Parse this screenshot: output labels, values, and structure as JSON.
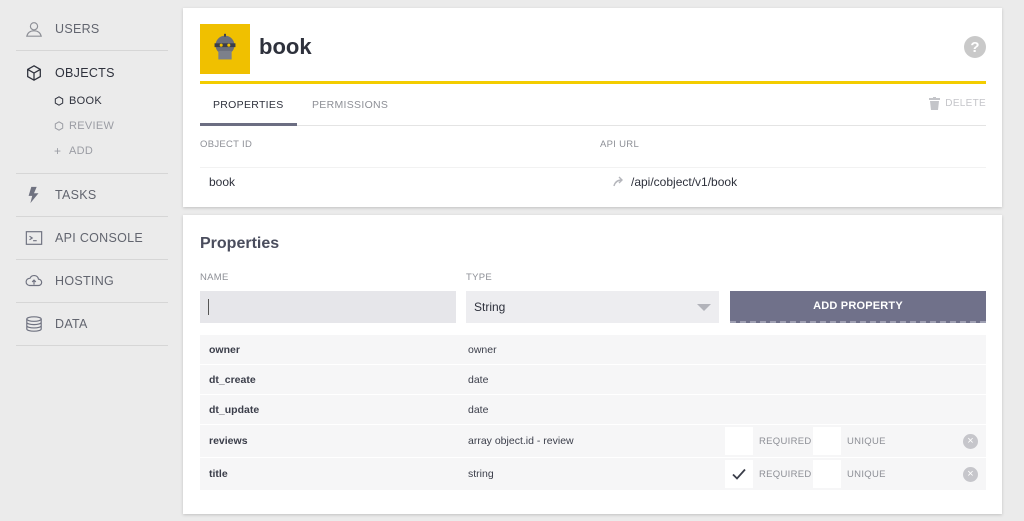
{
  "sidebar": {
    "items": [
      {
        "label": "USERS",
        "icon": "user-icon"
      },
      {
        "label": "OBJECTS",
        "icon": "cube-icon"
      },
      {
        "label": "TASKS",
        "icon": "bolt-icon"
      },
      {
        "label": "API CONSOLE",
        "icon": "terminal-icon"
      },
      {
        "label": "HOSTING",
        "icon": "cloud-upload-icon"
      },
      {
        "label": "DATA",
        "icon": "database-icon"
      }
    ],
    "objects": [
      {
        "label": "BOOK"
      },
      {
        "label": "REVIEW"
      },
      {
        "label": "ADD"
      }
    ]
  },
  "object": {
    "title": "book",
    "help": "?",
    "tabs": [
      "PROPERTIES",
      "PERMISSIONS"
    ],
    "delete_label": "DELETE",
    "object_id_label": "OBJECT ID",
    "object_id": "book",
    "api_url_label": "API URL",
    "api_url": "/api/cobject/v1/book"
  },
  "properties": {
    "title": "Properties",
    "name_label": "NAME",
    "name_value": "",
    "type_label": "TYPE",
    "type_value": "String",
    "add_button": "ADD PROPERTY",
    "required_label": "REQUIRED",
    "unique_label": "UNIQUE",
    "rows": [
      {
        "name": "owner",
        "type": "owner"
      },
      {
        "name": "dt_create",
        "type": "date"
      },
      {
        "name": "dt_update",
        "type": "date"
      },
      {
        "name": "reviews",
        "type": "array object.id - review",
        "required": false,
        "unique": false
      },
      {
        "name": "title",
        "type": "string",
        "required": true,
        "unique": false
      }
    ]
  },
  "colors": {
    "accent": "#f3cd00",
    "button": "#70718a",
    "tab_underline": "#6c6e82"
  }
}
